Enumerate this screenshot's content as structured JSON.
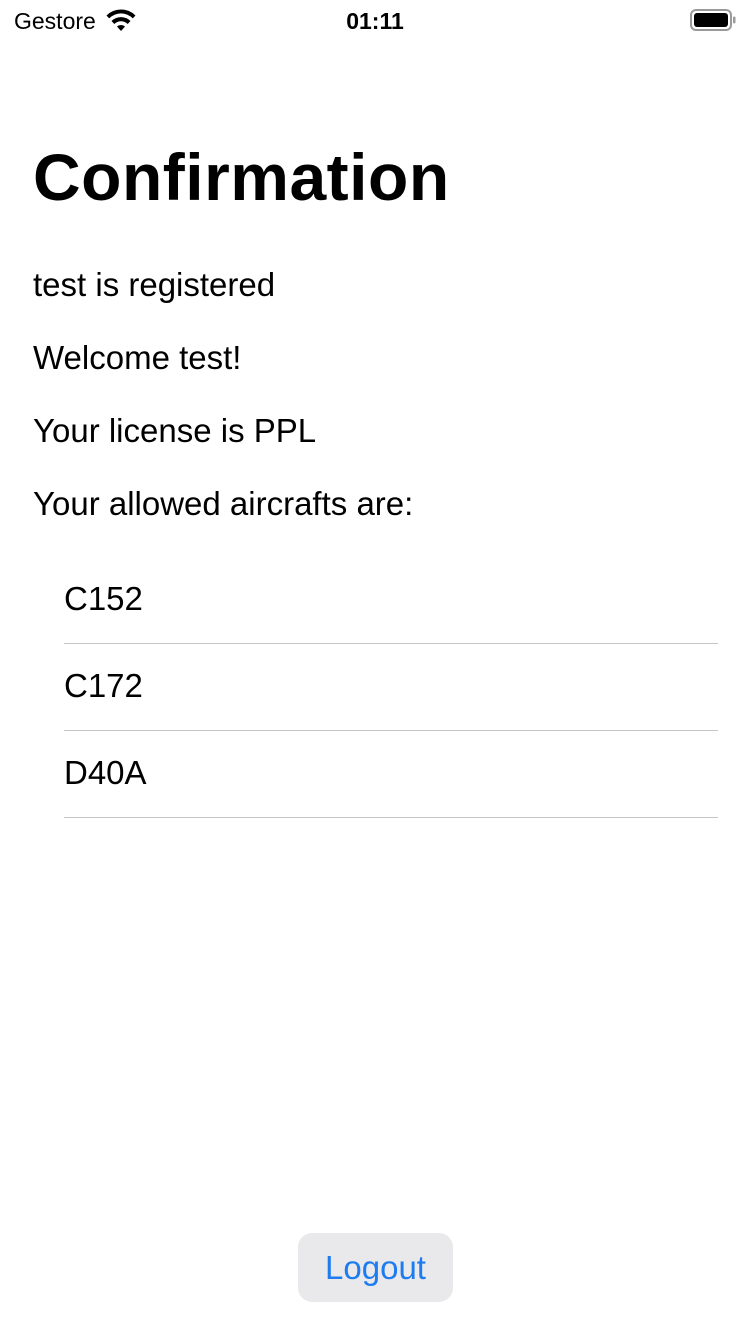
{
  "status_bar": {
    "carrier": "Gestore",
    "time": "01:11",
    "wifi_icon": "wifi-icon",
    "battery_icon": "battery-full-icon"
  },
  "page": {
    "title": "Confirmation",
    "registered_text": "test is registered",
    "welcome_text": "Welcome test!",
    "license_text": "Your license is PPL",
    "aircrafts_heading": "Your allowed aircrafts are:"
  },
  "aircrafts": [
    "C152",
    "C172",
    "D40A"
  ],
  "actions": {
    "logout_label": "Logout"
  },
  "colors": {
    "accent": "#1e7cf0",
    "button_bg": "#e9e9eb",
    "separator": "#c6c6c8"
  }
}
